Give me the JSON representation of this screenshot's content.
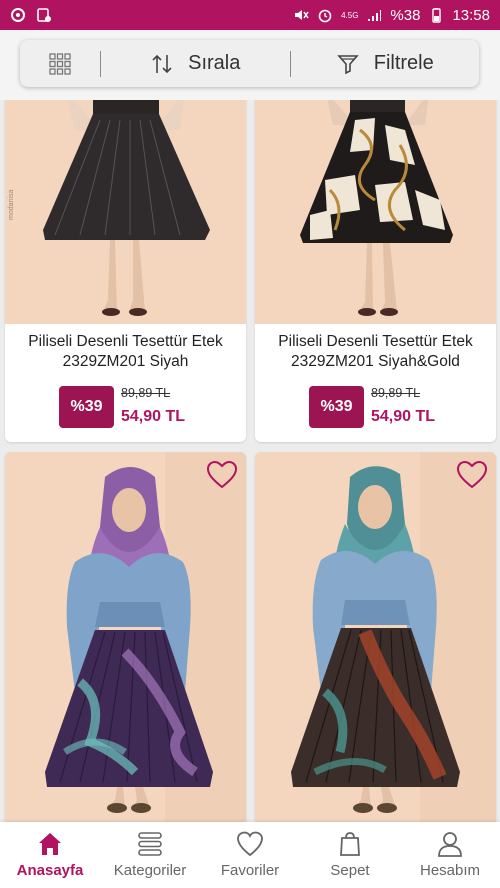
{
  "status_bar": {
    "network": "4.5G",
    "battery": "%38",
    "time": "13:58"
  },
  "toolbar": {
    "sort_label": "Sırala",
    "filter_label": "Filtrele"
  },
  "products": [
    {
      "title": "Piliseli Desenli Tesettür Etek 2329ZM201 Siyah",
      "discount": "%39",
      "old_price": "89,89 TL",
      "new_price": "54,90 TL"
    },
    {
      "title": "Piliseli Desenli Tesettür Etek 2329ZM201 Siyah&Gold",
      "discount": "%39",
      "old_price": "89,89 TL",
      "new_price": "54,90 TL"
    },
    {
      "title": "",
      "discount": "",
      "old_price": "",
      "new_price": ""
    },
    {
      "title": "",
      "discount": "",
      "old_price": "",
      "new_price": ""
    }
  ],
  "bottom_nav": {
    "home": "Anasayfa",
    "categories": "Kategoriler",
    "favorites": "Favoriler",
    "cart": "Sepet",
    "account": "Hesabım"
  },
  "colors": {
    "brand": "#b0135f",
    "badge": "#9c1552"
  }
}
